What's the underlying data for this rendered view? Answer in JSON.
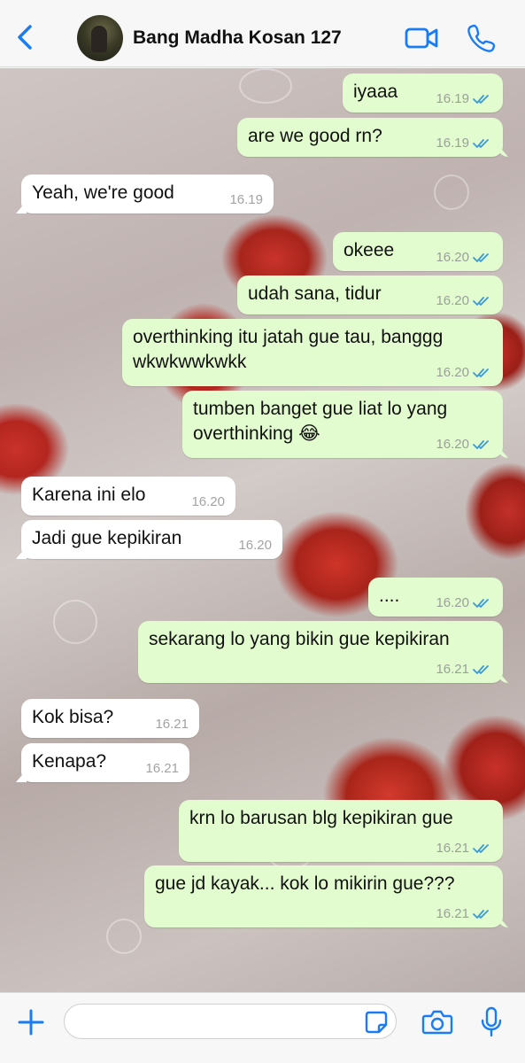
{
  "header": {
    "contact_name": "Bang Madha Kosan 127"
  },
  "colors": {
    "accent": "#1a7cf5",
    "outgoing_bubble": "#e2fbcf",
    "incoming_bubble": "#ffffff",
    "read_ticks": "#3a9ad9"
  },
  "messages": [
    {
      "dir": "out",
      "text": "iyaaa",
      "time": "16.19",
      "status": "read"
    },
    {
      "dir": "out",
      "text": "are we good rn?",
      "time": "16.19",
      "status": "read"
    },
    {
      "dir": "in",
      "text": "Yeah, we're good",
      "time": "16.19"
    },
    {
      "dir": "out",
      "text": "okeee",
      "time": "16.20",
      "status": "read"
    },
    {
      "dir": "out",
      "text": "udah sana, tidur",
      "time": "16.20",
      "status": "read"
    },
    {
      "dir": "out",
      "text": "overthinking itu jatah gue tau, banggg\nwkwkwwkwkk",
      "time": "16.20",
      "status": "read"
    },
    {
      "dir": "out",
      "text": "tumben banget gue liat lo yang\noverthinking 😂",
      "time": "16.20",
      "status": "read"
    },
    {
      "dir": "in",
      "text": "Karena ini elo",
      "time": "16.20"
    },
    {
      "dir": "in",
      "text": "Jadi gue kepikiran",
      "time": "16.20"
    },
    {
      "dir": "out",
      "text": "....",
      "time": "16.20",
      "status": "read"
    },
    {
      "dir": "out",
      "text": "sekarang lo yang bikin gue kepikiran",
      "time": "16.21",
      "status": "read"
    },
    {
      "dir": "in",
      "text": "Kok bisa?",
      "time": "16.21"
    },
    {
      "dir": "in",
      "text": "Kenapa?",
      "time": "16.21"
    },
    {
      "dir": "out",
      "text": "krn lo barusan blg kepikiran gue",
      "time": "16.21",
      "status": "read"
    },
    {
      "dir": "out",
      "text": "gue jd kayak... kok lo mikirin gue???",
      "time": "16.21",
      "status": "read"
    }
  ],
  "composer": {
    "value": "",
    "placeholder": ""
  },
  "icons": {
    "back": "chevron-left-icon",
    "video_call": "video-camera-icon",
    "voice_call": "phone-icon",
    "attach": "plus-icon",
    "sticker": "sticker-icon",
    "camera": "camera-icon",
    "mic": "microphone-icon"
  }
}
